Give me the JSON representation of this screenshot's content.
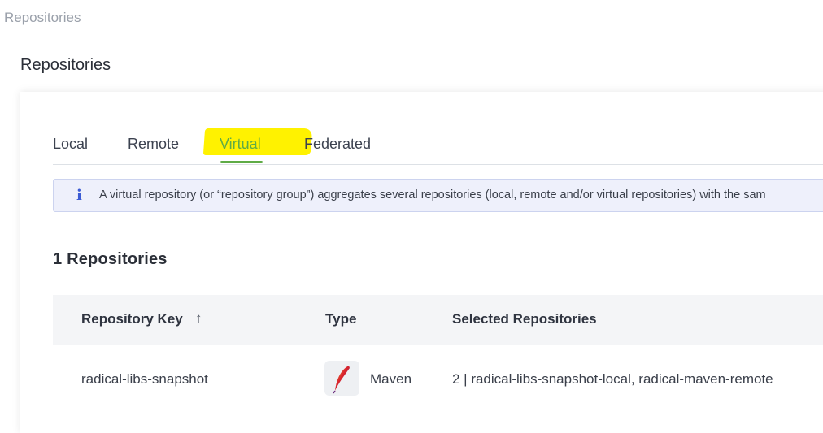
{
  "breadcrumb": "Repositories",
  "page_title": "Repositories",
  "tabs": [
    {
      "label": "Local"
    },
    {
      "label": "Remote"
    },
    {
      "label": "Virtual",
      "active": true
    },
    {
      "label": "Federated"
    }
  ],
  "info": {
    "icon": "info-icon",
    "text": "A virtual repository (or “repository group”) aggregates several repositories (local, remote and/or virtual repositories) with the sam"
  },
  "count_label": "1 Repositories",
  "table": {
    "columns": [
      "Repository Key",
      "Type",
      "Selected Repositories"
    ],
    "sort_icon": "arrow-up-icon",
    "rows": [
      {
        "key": "radical-libs-snapshot",
        "type": "Maven",
        "type_icon": "maven-feather-icon",
        "selected": "2 | radical-libs-snapshot-local, radical-maven-remote"
      }
    ]
  },
  "colors": {
    "accent": "#5fab46",
    "highlight": "#fff200",
    "info_bg": "#eef0fb",
    "info_icon": "#3b5bd4"
  }
}
